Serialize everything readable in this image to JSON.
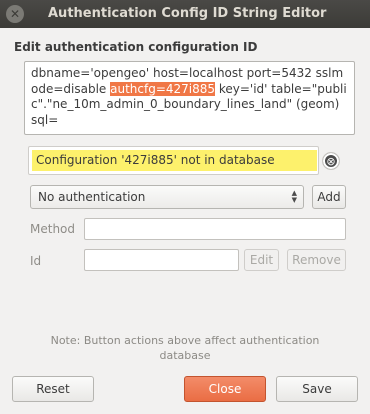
{
  "window": {
    "title": "Authentication Config ID String Editor",
    "close_glyph": "✕"
  },
  "section_label": "Edit authentication configuration ID",
  "config_text": {
    "before": "dbname='opengeo' host=localhost port=5432 sslmode=disable ",
    "highlight": "authcfg=427i885",
    "after": " key='id' table=\"public\".\"ne_10m_admin_0_boundary_lines_land\" (geom) sql="
  },
  "message": {
    "text": "Configuration '427i885' not in database",
    "clear_icon": "⊗",
    "background": "#fdf16c"
  },
  "auth_select": {
    "selected": "No authentication",
    "arrow_up": "▲",
    "arrow_down": "▼"
  },
  "buttons": {
    "add": "Add",
    "edit": "Edit",
    "remove": "Remove",
    "reset": "Reset",
    "close": "Close",
    "save": "Save"
  },
  "fields": {
    "method_label": "Method",
    "method_value": "",
    "id_label": "Id",
    "id_value": ""
  },
  "note": "Note: Button actions above affect authentication database",
  "colors": {
    "titlebar": "#3c3b37",
    "highlight": "#f07746",
    "primary_button": "#ea6d44"
  }
}
